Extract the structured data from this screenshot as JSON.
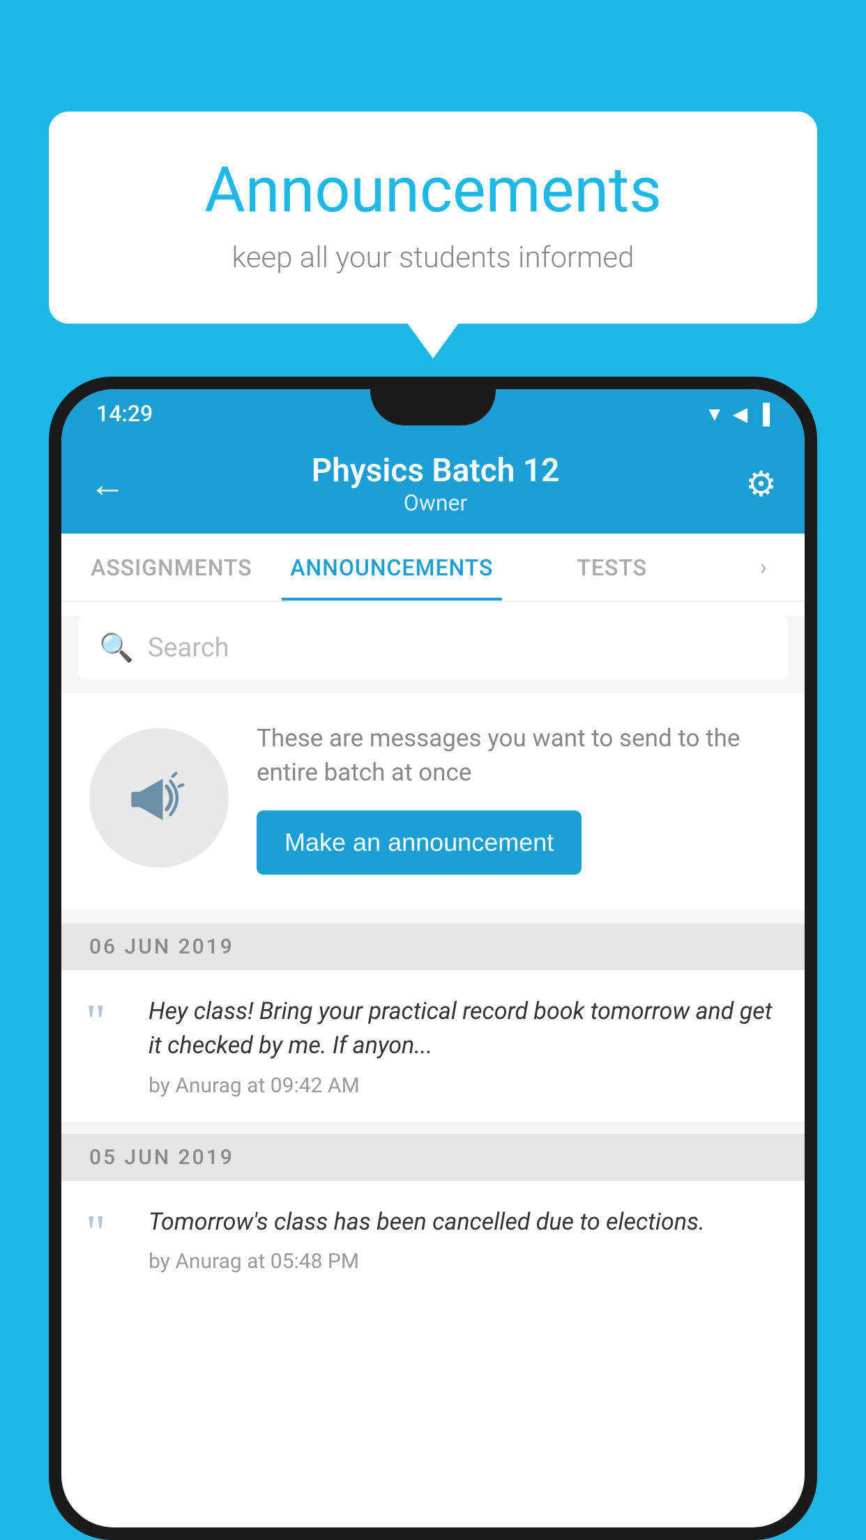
{
  "bubble": {
    "title": "Announcements",
    "subtitle": "keep all your students informed"
  },
  "statusBar": {
    "time": "14:29",
    "icons": "▼◀▐"
  },
  "appBar": {
    "title": "Physics Batch 12",
    "subtitle": "Owner",
    "backLabel": "←",
    "gearLabel": "⚙"
  },
  "tabs": [
    {
      "label": "ASSIGNMENTS",
      "active": false
    },
    {
      "label": "ANNOUNCEMENTS",
      "active": true
    },
    {
      "label": "TESTS",
      "active": false
    }
  ],
  "search": {
    "placeholder": "Search"
  },
  "announcementPrompt": {
    "description": "These are messages you want to send to the entire batch at once",
    "buttonLabel": "Make an announcement"
  },
  "announcements": [
    {
      "date": "06  JUN  2019",
      "text": "Hey class! Bring your practical record book tomorrow and get it checked by me. If anyon...",
      "meta": "by Anurag at 09:42 AM"
    },
    {
      "date": "05  JUN  2019",
      "text": "Tomorrow's class has been cancelled due to elections.",
      "meta": "by Anurag at 05:48 PM"
    }
  ],
  "colors": {
    "primary": "#1a9ed4",
    "background": "#1DB8E8",
    "tabActive": "#1a9ed4"
  }
}
